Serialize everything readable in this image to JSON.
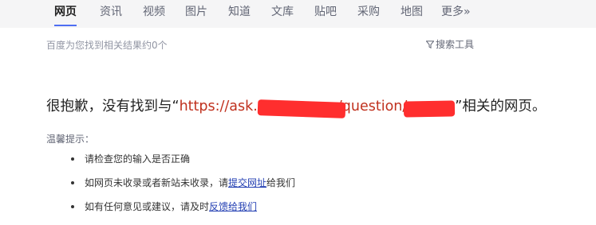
{
  "tabs": [
    {
      "label": "网页",
      "active": true
    },
    {
      "label": "资讯"
    },
    {
      "label": "视频"
    },
    {
      "label": "图片"
    },
    {
      "label": "知道"
    },
    {
      "label": "文库"
    },
    {
      "label": "贴吧"
    },
    {
      "label": "采购"
    },
    {
      "label": "地图"
    },
    {
      "label": "更多»"
    }
  ],
  "result_count": "百度为您找到相关结果约0个",
  "search_tools": {
    "label": "搜索工具",
    "icon": "funnel-icon"
  },
  "headline": {
    "prefix": "很抱歉，没有找到与“",
    "query": "https://ask.",
    "query_mid": "/question/",
    "suffix": "”相关的网页。"
  },
  "tips": {
    "title": "温馨提示：",
    "items": [
      {
        "text": "请检查您的输入是否正确"
      },
      {
        "text_before": "如网页未收录或者新站未收录，请",
        "link": "提交网址",
        "text_after": "给我们"
      },
      {
        "text_before": "如有任何意见或建议，请及时",
        "link": "反馈给我们",
        "text_after": ""
      }
    ]
  },
  "colors": {
    "tab_bar_bg": "#f5f5f6",
    "active_underline": "#4e6ef2",
    "query_red": "#c0311e",
    "link_blue": "#2440b3",
    "redaction_red": "#ff2e2e"
  }
}
